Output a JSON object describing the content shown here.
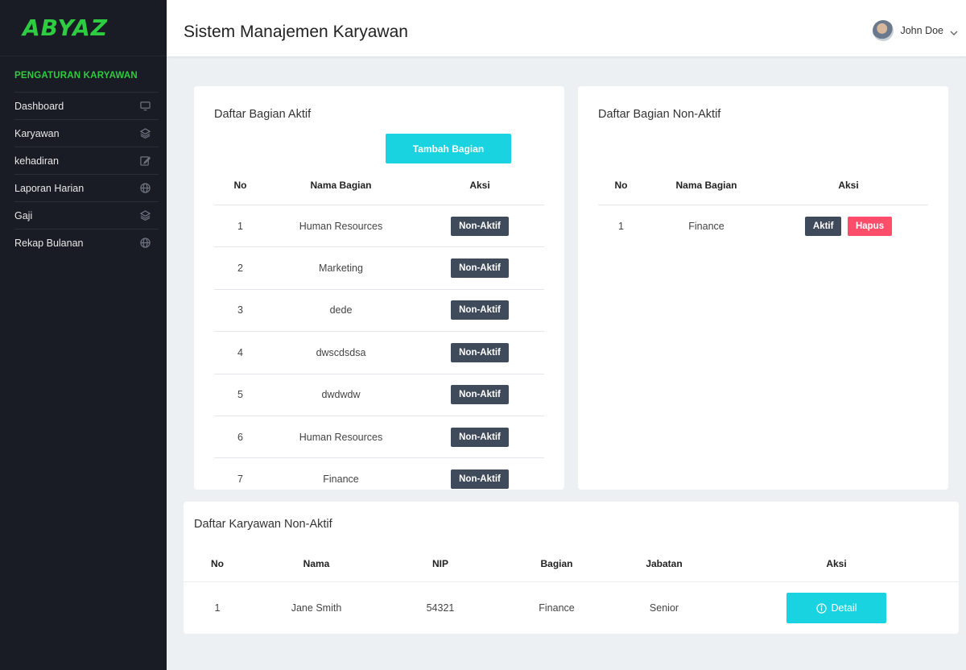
{
  "brand": {
    "logo_text": "ABYAZ",
    "accent": "#2ecc40"
  },
  "sidebar": {
    "section_title": "PENGATURAN KARYAWAN",
    "items": [
      {
        "label": "Dashboard",
        "icon": "monitor-icon"
      },
      {
        "label": "Karyawan",
        "icon": "layers-icon"
      },
      {
        "label": "kehadiran",
        "icon": "edit-icon"
      },
      {
        "label": "Laporan Harian",
        "icon": "globe-icon"
      },
      {
        "label": "Gaji",
        "icon": "layers-icon"
      },
      {
        "label": "Rekap Bulanan",
        "icon": "globe-icon"
      }
    ]
  },
  "header": {
    "title": "Sistem Manajemen Karyawan",
    "user_name": "John Doe"
  },
  "active_departments": {
    "title": "Daftar Bagian Aktif",
    "add_button": "Tambah Bagian",
    "columns": [
      "No",
      "Nama Bagian",
      "Aksi"
    ],
    "action_label": "Non-Aktif",
    "rows": [
      {
        "no": "1",
        "name": "Human Resources"
      },
      {
        "no": "2",
        "name": "Marketing"
      },
      {
        "no": "3",
        "name": "dede"
      },
      {
        "no": "4",
        "name": "dwscdsdsa"
      },
      {
        "no": "5",
        "name": "dwdwdw"
      },
      {
        "no": "6",
        "name": "Human Resources"
      },
      {
        "no": "7",
        "name": "Finance"
      }
    ]
  },
  "inactive_departments": {
    "title": "Daftar Bagian Non-Aktif",
    "columns": [
      "No",
      "Nama Bagian",
      "Aksi"
    ],
    "rows": [
      {
        "no": "1",
        "name": "Finance",
        "activate_label": "Aktif",
        "delete_label": "Hapus"
      }
    ]
  },
  "inactive_employees": {
    "title": "Daftar Karyawan Non-Aktif",
    "columns": [
      "No",
      "Nama",
      "NIP",
      "Bagian",
      "Jabatan",
      "Aksi"
    ],
    "rows": [
      {
        "no": "1",
        "nama": "Jane Smith",
        "nip": "54321",
        "bagian": "Finance",
        "jabatan": "Senior",
        "action_label": "Detail"
      }
    ]
  },
  "colors": {
    "sidebar_bg": "#191c24",
    "cyan": "#19d3e0",
    "dark_button": "#3f4a5a",
    "danger": "#ff4d6a"
  }
}
